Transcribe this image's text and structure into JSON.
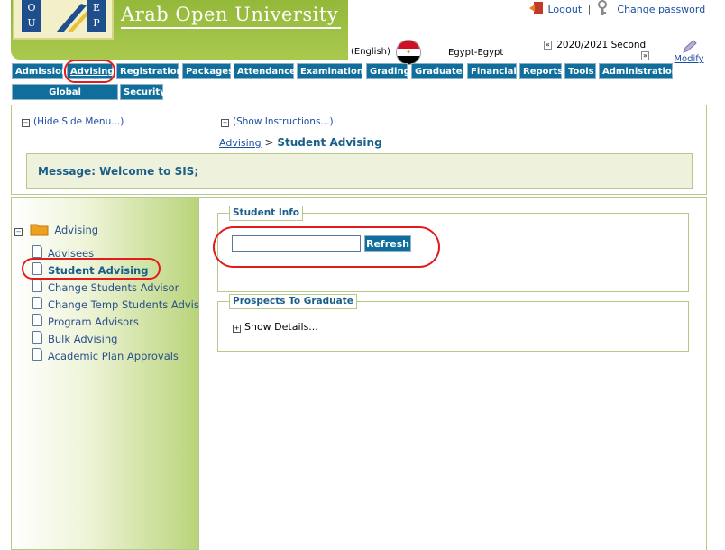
{
  "header": {
    "university_name": "Arab Open University",
    "logo_letters": [
      "O",
      "U",
      "E",
      "P"
    ],
    "logout_label": "Logout",
    "separator": "|",
    "change_password_label": "Change password",
    "language_label": "(English)",
    "country_label": "Egypt-Egypt",
    "term_label": "2020/2021 Second",
    "modify_label": "Modify"
  },
  "nav": {
    "row1": [
      "Admission",
      "Advising",
      "Registration",
      "Packages",
      "Attendance",
      "Examinations",
      "Grading",
      "Graduates",
      "Financials",
      "Reports",
      "Tools",
      "Administration"
    ],
    "row2": [
      "Global Administration",
      "Security"
    ],
    "active": "Advising"
  },
  "toggles": {
    "hide_side_menu": "(Hide Side Menu...)",
    "show_instructions": "(Show Instructions...)"
  },
  "breadcrumb": {
    "parent": "Advising",
    "separator": ">",
    "current": "Student Advising"
  },
  "message": "Message: Welcome to SIS;",
  "sidebar": {
    "folder_label": "Advising",
    "items": [
      "Advisees",
      "Student Advising",
      "Change Students Advisor",
      "Change Temp Students Advis",
      "Program Advisors",
      "Bulk Advising",
      "Academic Plan Approvals"
    ],
    "active_index": 1
  },
  "student_info": {
    "legend": "Student Info",
    "input_value": "",
    "refresh_label": "Refresh"
  },
  "prospects": {
    "legend": "Prospects To Graduate",
    "show_details_label": "Show Details..."
  },
  "colors": {
    "nav_bg": "#0f6e9c",
    "banner_green": "#a9c94e",
    "annotation_red": "#e21b1b",
    "link_blue": "#1a4fa0"
  }
}
